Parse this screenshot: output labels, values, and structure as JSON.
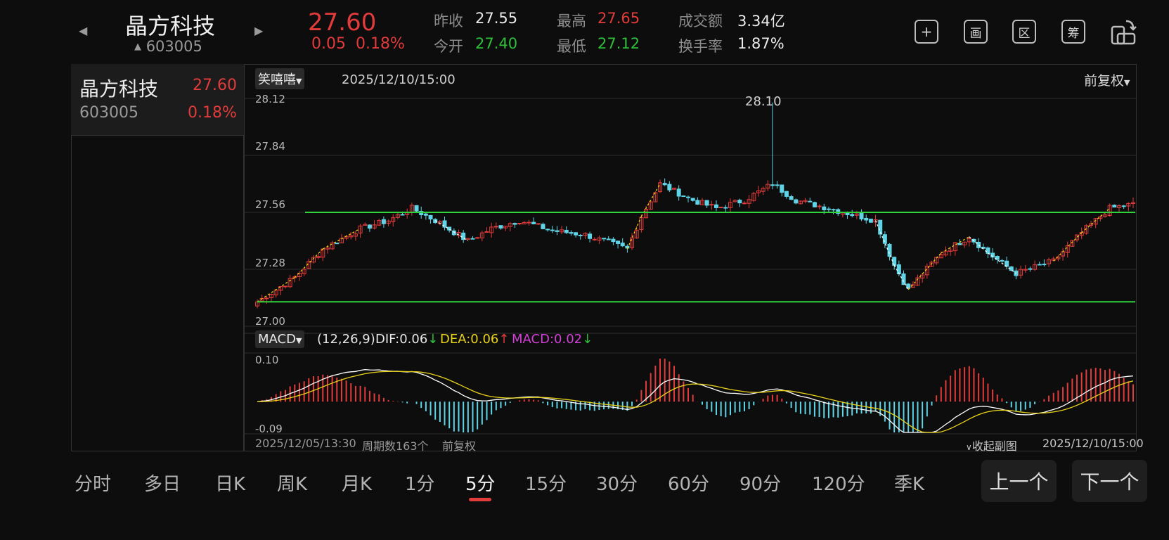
{
  "header": {
    "stock_name": "晶方科技",
    "stock_code": "603005",
    "code_arrow": "▲",
    "price": "27.60",
    "change": "0.05",
    "change_pct": "0.18%",
    "stats": {
      "prev_close_label": "昨收",
      "prev_close": "27.55",
      "open_label": "今开",
      "open": "27.40",
      "high_label": "最高",
      "high": "27.65",
      "low_label": "最低",
      "low": "27.12",
      "turnover_label": "成交额",
      "turnover": "3.34亿",
      "turnover_rate_label": "换手率",
      "turnover_rate": "1.87%"
    },
    "tools": [
      {
        "name": "add",
        "glyph": "+"
      },
      {
        "name": "draw",
        "glyph": "画"
      },
      {
        "name": "range",
        "glyph": "区"
      },
      {
        "name": "chip",
        "glyph": "筹"
      }
    ]
  },
  "watchlist": [
    {
      "name": "晶方科技",
      "price": "27.60",
      "code": "603005",
      "pct": "0.18%"
    }
  ],
  "chart": {
    "indicator_tag": "笑嘻嘻",
    "datetime": "2025/12/10/15:00",
    "adjust_label": "前复权",
    "y_ticks": [
      "28.12",
      "27.84",
      "27.56",
      "27.28",
      "27.00"
    ],
    "peak_label": "28.10",
    "macd_tag": "MACD",
    "macd_params": "(12,26,9)",
    "dif_text": "DIF:0.06",
    "dea_text": "DEA:0.06",
    "macd_text": "MACD:0.02",
    "macd_top": "0.10",
    "macd_bottom": "-0.09",
    "start_time": "2025/12/05/13:30",
    "period_count": "周期数163个",
    "bottom_adjust": "前复权",
    "collapse_label": "收起副图",
    "end_time": "2025/12/10/15:00"
  },
  "chart_data": {
    "type": "candlestick",
    "ylim": [
      27.0,
      28.12
    ],
    "support_line": 27.12,
    "resistance_line": 27.56,
    "price_waypoints": [
      [
        0,
        27.12
      ],
      [
        8,
        27.24
      ],
      [
        14,
        27.38
      ],
      [
        22,
        27.48
      ],
      [
        28,
        27.52
      ],
      [
        33,
        27.58
      ],
      [
        38,
        27.52
      ],
      [
        45,
        27.42
      ],
      [
        50,
        27.48
      ],
      [
        56,
        27.52
      ],
      [
        63,
        27.47
      ],
      [
        70,
        27.45
      ],
      [
        79,
        27.38
      ],
      [
        82,
        27.54
      ],
      [
        86,
        27.7
      ],
      [
        93,
        27.62
      ],
      [
        98,
        27.58
      ],
      [
        104,
        27.62
      ],
      [
        110,
        27.7
      ],
      [
        115,
        27.62
      ],
      [
        122,
        27.58
      ],
      [
        132,
        27.52
      ],
      [
        136,
        27.3
      ],
      [
        139,
        27.18
      ],
      [
        146,
        27.36
      ],
      [
        152,
        27.44
      ],
      [
        156,
        27.36
      ],
      [
        162,
        27.26
      ],
      [
        170,
        27.32
      ],
      [
        176,
        27.46
      ],
      [
        182,
        27.58
      ],
      [
        187,
        27.6
      ]
    ],
    "peak_candle_index": 110,
    "macd_range": [
      -0.09,
      0.1
    ],
    "colors": {
      "up": "#e23b3b",
      "down": "#5fd4e6",
      "dif": "#ffffff",
      "dea": "#e8d21a",
      "lines": "#2fd43a"
    }
  },
  "tabs": {
    "items": [
      "分时",
      "多日",
      "日K",
      "周K",
      "月K",
      "1分",
      "5分",
      "15分",
      "30分",
      "60分",
      "90分",
      "120分",
      "季K"
    ],
    "active_index": 6,
    "prev_label": "上一个",
    "next_label": "下一个"
  }
}
